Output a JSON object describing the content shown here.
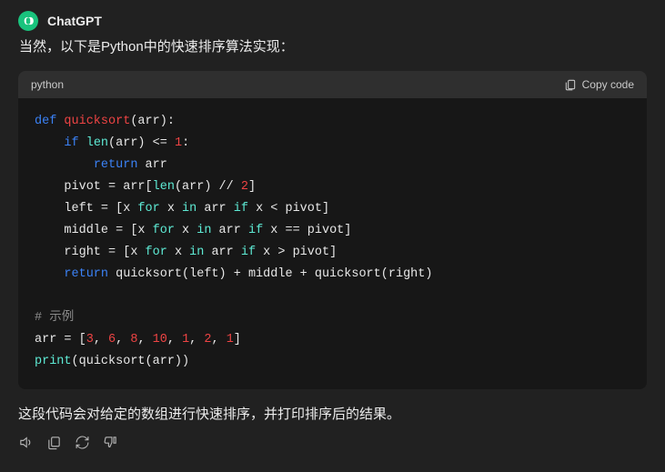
{
  "author": "ChatGPT",
  "intro_text": "当然，以下是Python中的快速排序算法实现：",
  "code": {
    "language_label": "python",
    "copy_label": "Copy code",
    "tokens": [
      [
        {
          "t": "def ",
          "c": "kw"
        },
        {
          "t": "quicksort",
          "c": "fn"
        },
        {
          "t": "(arr):",
          "c": ""
        }
      ],
      [
        {
          "t": "    ",
          "c": ""
        },
        {
          "t": "if",
          "c": "kw"
        },
        {
          "t": " ",
          "c": ""
        },
        {
          "t": "len",
          "c": "bi"
        },
        {
          "t": "(arr) <= ",
          "c": ""
        },
        {
          "t": "1",
          "c": "num"
        },
        {
          "t": ":",
          "c": ""
        }
      ],
      [
        {
          "t": "        ",
          "c": ""
        },
        {
          "t": "return",
          "c": "kw"
        },
        {
          "t": " arr",
          "c": ""
        }
      ],
      [
        {
          "t": "    pivot = arr[",
          "c": ""
        },
        {
          "t": "len",
          "c": "bi"
        },
        {
          "t": "(arr) // ",
          "c": ""
        },
        {
          "t": "2",
          "c": "num"
        },
        {
          "t": "]",
          "c": ""
        }
      ],
      [
        {
          "t": "    left = [x ",
          "c": ""
        },
        {
          "t": "for",
          "c": "for"
        },
        {
          "t": " x ",
          "c": ""
        },
        {
          "t": "in",
          "c": "for"
        },
        {
          "t": " arr ",
          "c": ""
        },
        {
          "t": "if",
          "c": "for"
        },
        {
          "t": " x < pivot]",
          "c": ""
        }
      ],
      [
        {
          "t": "    middle = [x ",
          "c": ""
        },
        {
          "t": "for",
          "c": "for"
        },
        {
          "t": " x ",
          "c": ""
        },
        {
          "t": "in",
          "c": "for"
        },
        {
          "t": " arr ",
          "c": ""
        },
        {
          "t": "if",
          "c": "for"
        },
        {
          "t": " x == pivot]",
          "c": ""
        }
      ],
      [
        {
          "t": "    right = [x ",
          "c": ""
        },
        {
          "t": "for",
          "c": "for"
        },
        {
          "t": " x ",
          "c": ""
        },
        {
          "t": "in",
          "c": "for"
        },
        {
          "t": " arr ",
          "c": ""
        },
        {
          "t": "if",
          "c": "for"
        },
        {
          "t": " x > pivot]",
          "c": ""
        }
      ],
      [
        {
          "t": "    ",
          "c": ""
        },
        {
          "t": "return",
          "c": "kw"
        },
        {
          "t": " quicksort(left) + middle + quicksort(right)",
          "c": ""
        }
      ],
      [],
      [
        {
          "t": "# 示例",
          "c": "cmt"
        }
      ],
      [
        {
          "t": "arr = [",
          "c": ""
        },
        {
          "t": "3",
          "c": "num"
        },
        {
          "t": ", ",
          "c": ""
        },
        {
          "t": "6",
          "c": "num"
        },
        {
          "t": ", ",
          "c": ""
        },
        {
          "t": "8",
          "c": "num"
        },
        {
          "t": ", ",
          "c": ""
        },
        {
          "t": "10",
          "c": "num"
        },
        {
          "t": ", ",
          "c": ""
        },
        {
          "t": "1",
          "c": "num"
        },
        {
          "t": ", ",
          "c": ""
        },
        {
          "t": "2",
          "c": "num"
        },
        {
          "t": ", ",
          "c": ""
        },
        {
          "t": "1",
          "c": "num"
        },
        {
          "t": "]",
          "c": ""
        }
      ],
      [
        {
          "t": "print",
          "c": "bi"
        },
        {
          "t": "(quicksort(arr))",
          "c": ""
        }
      ]
    ]
  },
  "outro_text": "这段代码会对给定的数组进行快速排序，并打印排序后的结果。"
}
